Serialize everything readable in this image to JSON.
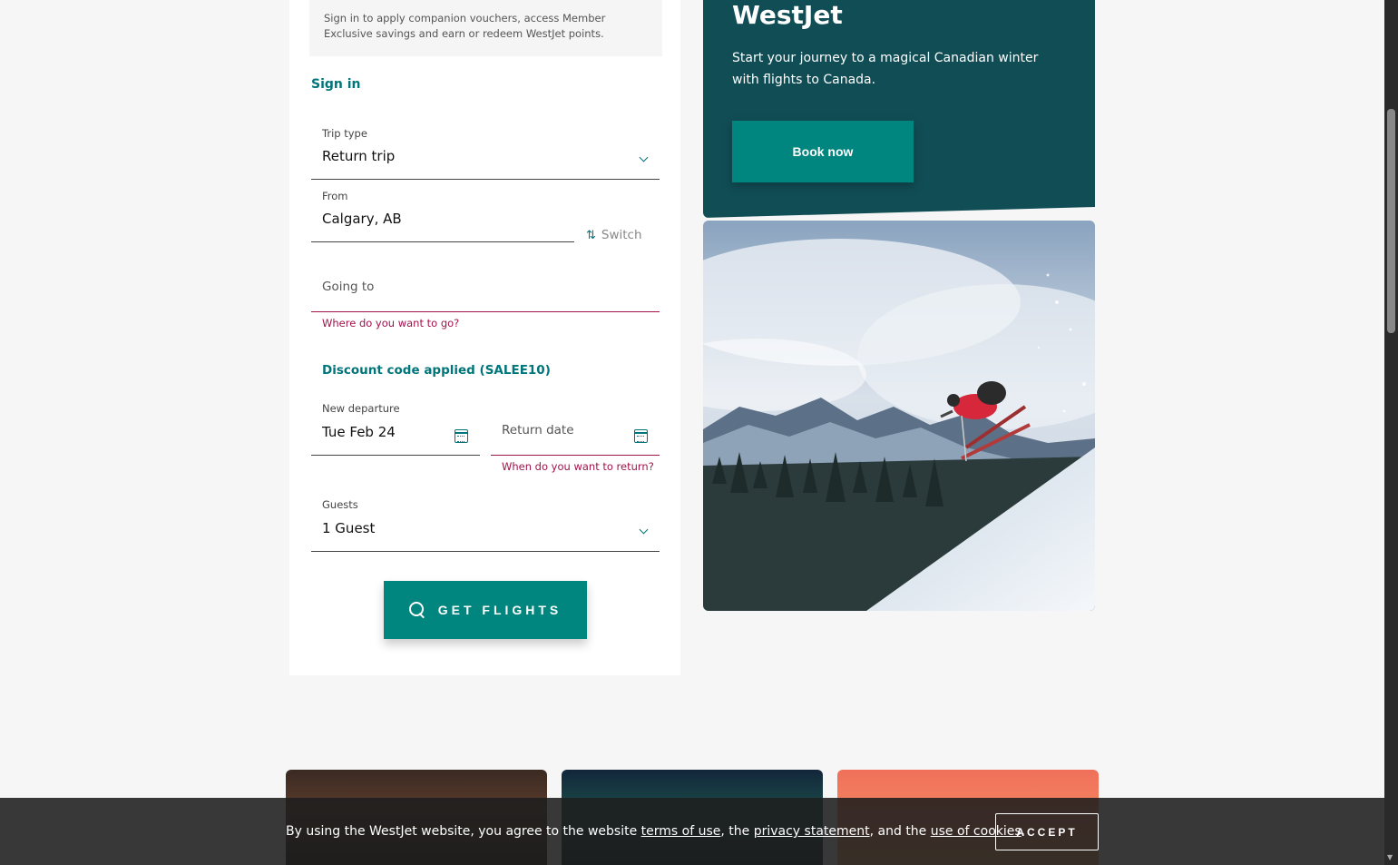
{
  "booking": {
    "signin_note": "Sign in to apply companion vouchers, access Member Exclusive savings and earn or redeem WestJet points.",
    "signin_link": "Sign in",
    "trip_type": {
      "label": "Trip type",
      "value": "Return trip"
    },
    "from": {
      "label": "From",
      "value": "Calgary, AB"
    },
    "switch_label": "Switch",
    "going_to": {
      "placeholder": "Going to",
      "error": "Where do you want to go?"
    },
    "discount": "Discount code applied (SALEE10)",
    "departure": {
      "label": "New departure",
      "value": "Tue Feb 24"
    },
    "return_date": {
      "placeholder": "Return date",
      "error": "When do you want to return?"
    },
    "guests": {
      "label": "Guests",
      "value": "1 Guest"
    },
    "get_flights": "GET FLIGHTS"
  },
  "promo": {
    "title": "WestJet",
    "text": "Start your journey to a magical Canadian winter with flights to Canada.",
    "button": "Book now"
  },
  "cookie": {
    "text_before": "By using the WestJet website, you agree to the website ",
    "terms_link": "terms of use",
    "text_mid1": ", the ",
    "privacy_link": "privacy statement",
    "text_mid2": ", and the ",
    "cookies_link": "use of cookies",
    "text_end": ".",
    "accept": "ACCEPT"
  },
  "colors": {
    "accent": "#00857f",
    "promo_bg": "#114d55",
    "error": "#a0124a"
  },
  "icons": [
    "chevron-down-icon",
    "switch-arrows-icon",
    "calendar-icon",
    "search-icon"
  ]
}
